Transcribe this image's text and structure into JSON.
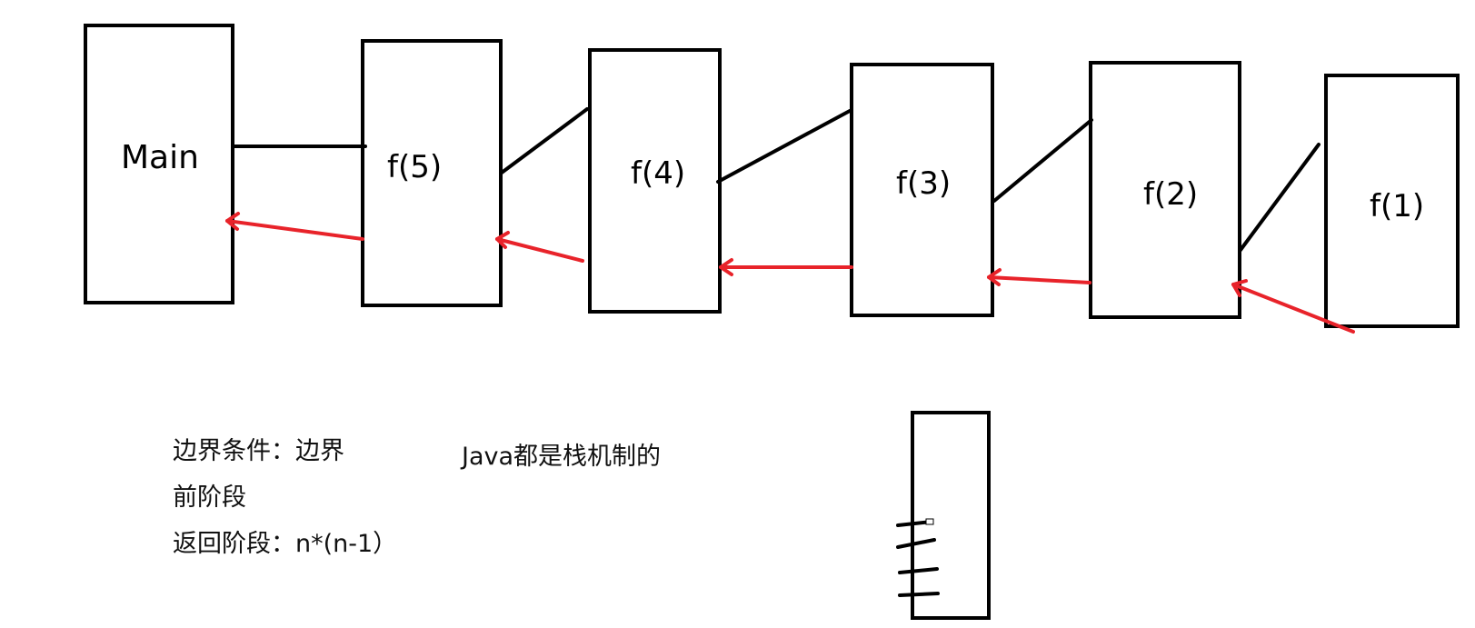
{
  "diagram": {
    "frames": [
      {
        "id": "main",
        "label": "Main"
      },
      {
        "id": "f5",
        "label": "f(5)"
      },
      {
        "id": "f4",
        "label": "f(4)"
      },
      {
        "id": "f3",
        "label": "f(3)"
      },
      {
        "id": "f2",
        "label": "f(2)"
      },
      {
        "id": "f1",
        "label": "f(1)"
      }
    ],
    "colors": {
      "stroke": "#000000",
      "return_arrow": "#e8232a",
      "background": "#ffffff"
    }
  },
  "notes": {
    "line1": "边界条件：边界",
    "line2": "前阶段",
    "line3": "返回阶段：n*(n-1）",
    "java_note": "Java都是栈机制的"
  }
}
